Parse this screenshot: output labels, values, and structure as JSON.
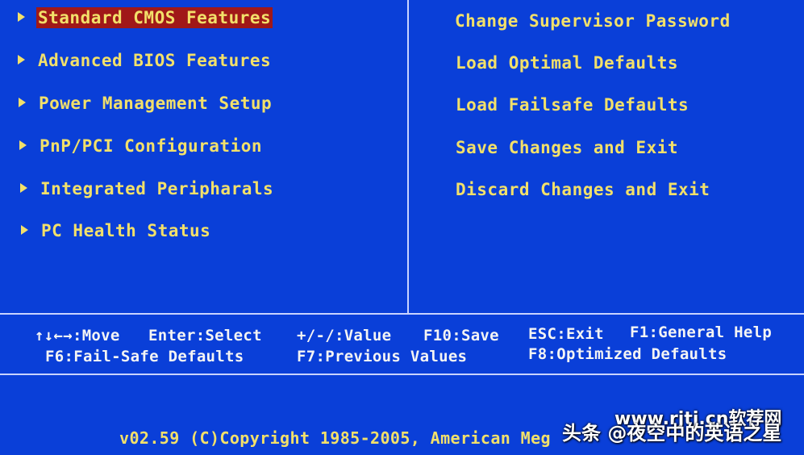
{
  "left_menu": [
    {
      "label": "Standard CMOS Features",
      "selected": true
    },
    {
      "label": "Advanced BIOS Features",
      "selected": false
    },
    {
      "label": "Power Management Setup",
      "selected": false
    },
    {
      "label": "PnP/PCI Configuration",
      "selected": false
    },
    {
      "label": "Integrated Peripharals",
      "selected": false
    },
    {
      "label": "PC Health Status",
      "selected": false
    }
  ],
  "right_menu": [
    {
      "label": "Change Supervisor Password"
    },
    {
      "label": "Load Optimal Defaults"
    },
    {
      "label": "Load Failsafe Defaults"
    },
    {
      "label": "Save Changes and Exit"
    },
    {
      "label": "Discard Changes and Exit"
    }
  ],
  "help": {
    "row1": {
      "move": "↑↓←→:Move",
      "select": "Enter:Select",
      "value": "+/-/:Value",
      "save": "F10:Save",
      "exit": "ESC:Exit",
      "help": "F1:General Help"
    },
    "row2": {
      "failsafe": "F6:Fail-Safe Defaults",
      "previous": "F7:Previous Values",
      "optimized": "F8:Optimized Defaults"
    }
  },
  "footer": {
    "copyright": "v02.59 (C)Copyright 1985-2005, American Meg"
  },
  "watermark": {
    "text1": "头条 @夜空中的英语之星",
    "text2": "www.rjtj.cn软荐网"
  },
  "colors": {
    "background": "#0a3fd8",
    "menu_text": "#f2e06a",
    "highlight": "#a01818",
    "help_text": "#f4f4f4"
  }
}
